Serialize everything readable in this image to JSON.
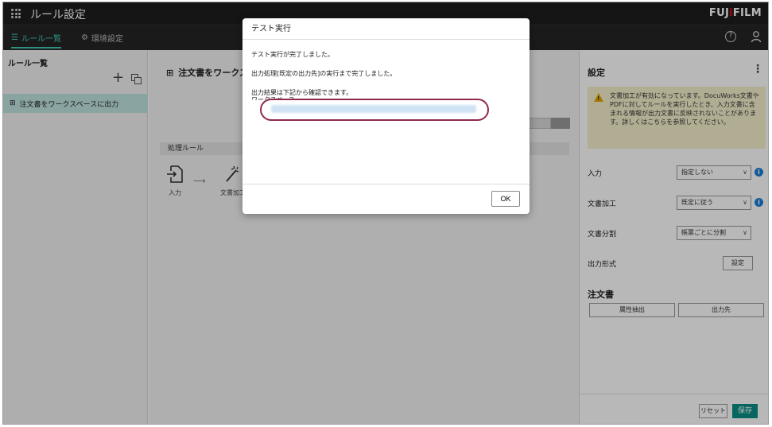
{
  "header": {
    "app_title": "ルール設定",
    "brand_prefix": "FUJ",
    "brand_accent": "i",
    "brand_suffix": "FILM"
  },
  "nav": {
    "tabs": [
      {
        "label": "ルール一覧",
        "icon": "list-icon",
        "active": true
      },
      {
        "label": "環境設定",
        "icon": "gear-icon",
        "active": false
      }
    ]
  },
  "left_panel": {
    "title": "ルール一覧",
    "items": [
      {
        "label": "注文書をワークスペースに出力",
        "selected": true
      }
    ]
  },
  "center": {
    "rule_title": "注文書をワークス",
    "section_label": "処理ルール",
    "steps": [
      {
        "label": "入力",
        "icon": "file-import-icon"
      },
      {
        "label": "文書加工",
        "icon": "magic-wand-icon"
      }
    ]
  },
  "settings": {
    "title": "設定",
    "warning": "文書加工が有効になっています。DocuWorks文書やPDFに対してルールを実行したとき、入力文書に含まれる情報が出力文書に反映されないことがあります。詳しくはこちらを参照してください。",
    "fields": [
      {
        "label": "入力",
        "value": "指定しない",
        "info": true
      },
      {
        "label": "文書加工",
        "value": "既定に従う",
        "info": true
      },
      {
        "label": "文書分割",
        "value": "帳票ごとに分割",
        "info": false
      }
    ],
    "output_format_label": "出力形式",
    "output_format_button": "設定",
    "doc_section": "注文書",
    "attr_button": "属性抽出",
    "dest_button": "出力先",
    "reset_button": "リセット",
    "save_button": "保存"
  },
  "dialog": {
    "title": "テスト実行",
    "line1": "テスト実行が完了しました。",
    "line2": "出力処理[既定の出力先]の実行まで完了しました。",
    "line3": "出力結果は下記から確認できます。",
    "line4": "ワークスペース",
    "ok_button": "OK"
  },
  "colors": {
    "accent": "#41c9b8",
    "save": "#0b8f86",
    "highlight": "#8e2a50",
    "warning_bg": "#f6f0cc"
  }
}
